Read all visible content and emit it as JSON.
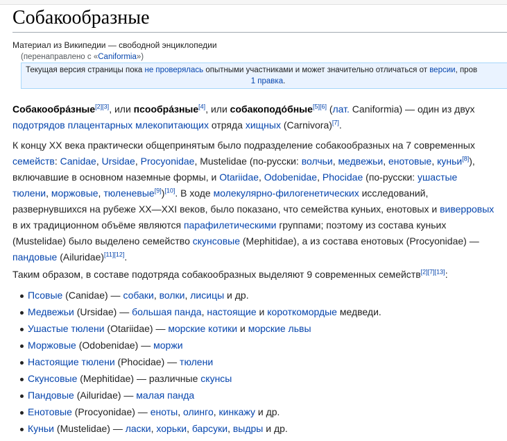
{
  "article": {
    "title": "Собакообразные",
    "site_sub": "Материал из Википедии — свободной энциклопедии",
    "redirect_prefix": "(перенаправлено с «",
    "redirect_link": "Caniformia",
    "redirect_suffix": "»)"
  },
  "flagged": {
    "part1": "Текущая версия страницы пока ",
    "link1": "не проверялась",
    "part2": " опытными участниками и может значительно отличаться от ",
    "link2": "версии",
    "part3": ", пров",
    "link3": "1 правка",
    "part4": "."
  },
  "para1": {
    "b1": "Собакообра́зные",
    "r1": "[2][3]",
    "t1": ", или ",
    "b2": "псообра́зные",
    "r2": "[4]",
    "t2": ", или ",
    "b3": "собакоподо́бные",
    "r3": "[5][6]",
    "t3": " (",
    "l1": "лат.",
    "t4": " Caniformia) — один из двух",
    "l2": "подотрядов",
    "t5": " ",
    "l3": "плацентарных",
    "t6": " ",
    "l4": "млекопитающих",
    "t7": " отряда ",
    "l5": "хищных",
    "t8": " (Carnivora)",
    "r4": "[7]",
    "t9": "."
  },
  "para2": {
    "t1": "К концу XX века практически общепринятым было подразделение собакообразных на 7 современных",
    "l1": "семейств",
    "t2": ": ",
    "l2": "Canidae",
    "t3": ", ",
    "l3": "Ursidae",
    "t4": ", ",
    "l4": "Procyonidae",
    "t5": ", ",
    "l5": "Mustelidae",
    "t6": " (по-русски: ",
    "l6": "волчьи",
    "t7": ", ",
    "l7": "медвежьи",
    "t8": ", ",
    "l8": "енотовые",
    "t9": ", ",
    "l9": "куньи",
    "r1": "[8]",
    "t10": "),",
    "t11": "включавшие в основном наземные формы, и ",
    "l10": "Otariidae",
    "t12": ", ",
    "l11": "Odobenidae",
    "t13": ", ",
    "l12": "Phocidae",
    "t14": " (по-русски: ",
    "l13": "ушастые",
    "l14": "тюлени",
    "t15": ", ",
    "l15": "моржовые",
    "t16": ", ",
    "l16": "тюленевые",
    "r2": "[9]",
    "t17": ")",
    "r3": "[10]",
    "t18": ". В ходе ",
    "l17": "молекулярно-филогенетических",
    "t19": " исследований,",
    "t20": "развернувшихся на рубеже XX—XXI веков, было показано, что семейства куньих, енотовых и ",
    "l18": "виверровых",
    "t21": "в их традиционном объёме являются ",
    "l19": "парафилетическими",
    "t22": " группами; поэтому из состава куньих",
    "t23": "(Mustelidae) было выделено семейство ",
    "l20": "скунсовые",
    "t24": " (Mephitidae), а из состава енотовых (Procyonidae) —",
    "l21": "пандовые",
    "t25": " (Ailuridae)",
    "r4": "[11][12]",
    "t26": "."
  },
  "para3": {
    "t1": "Таким образом, в составе подотряда собакообразных выделяют 9 современных семейств",
    "r1": "[2][7][13]",
    "t2": ":"
  },
  "families": [
    {
      "name": "Псовые",
      "latin": " (Canidae) — ",
      "links": [
        "собаки",
        "волки",
        "лисицы"
      ],
      "tail": " и др."
    },
    {
      "name": "Медвежьи",
      "latin": " (Ursidae) — ",
      "links": [
        "большая панда",
        "настоящие"
      ],
      "mid": " и ",
      "links2": [
        "короткомордые"
      ],
      "tail": " медведи."
    },
    {
      "name": "Ушастые тюлени",
      "latin": " (Otariidae) — ",
      "links": [
        "морские котики"
      ],
      "mid": " и ",
      "links2": [
        "морские львы"
      ],
      "tail": ""
    },
    {
      "name": "Моржовые",
      "latin": " (Odobenidae) — ",
      "links": [
        "моржи"
      ],
      "tail": ""
    },
    {
      "name": "Настоящие тюлени",
      "latin": " (Phocidae) — ",
      "links": [
        "тюлени"
      ],
      "tail": ""
    },
    {
      "name": "Скунсовые",
      "latin": " (Mephitidae) — различные ",
      "links": [
        "скунсы"
      ],
      "tail": ""
    },
    {
      "name": "Пандовые",
      "latin": " (Ailuridae) — ",
      "links": [
        "малая панда"
      ],
      "tail": ""
    },
    {
      "name": "Енотовые",
      "latin": " (Procyonidae) — ",
      "links": [
        "еноты",
        "олинго",
        "кинкажу"
      ],
      "tail": " и др."
    },
    {
      "name": "Куньи",
      "latin": " (Mustelidae) — ",
      "links": [
        "ласки",
        "хорьки",
        "барсуки",
        "выдры"
      ],
      "tail": " и др."
    }
  ]
}
